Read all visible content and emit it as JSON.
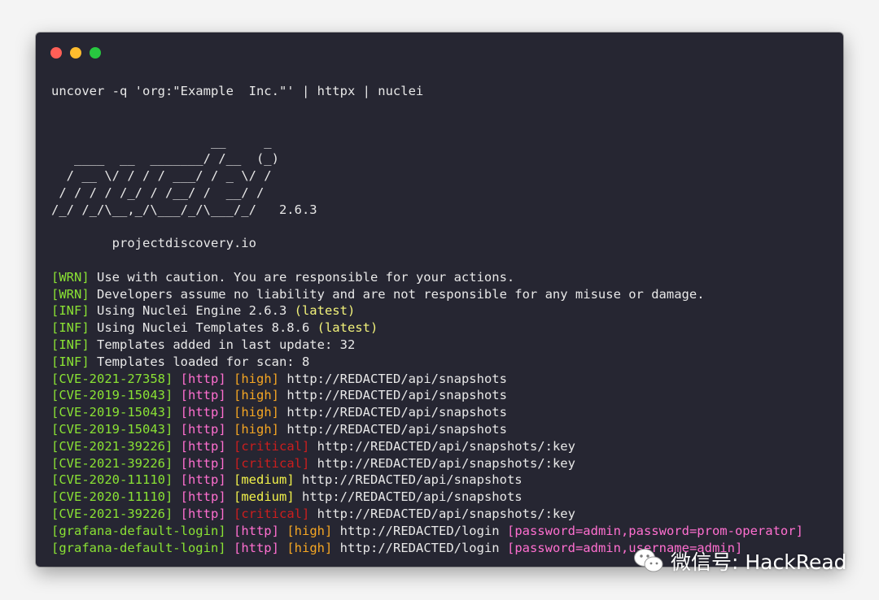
{
  "colors": {
    "close": "#ff5f57",
    "minimize": "#febc2e",
    "maximize": "#28c840",
    "tag_green": "#8ae234",
    "tag_pink": "#ff6fd0",
    "severity_high": "#f5a623",
    "severity_critical": "#cc1e1e",
    "severity_medium": "#f2f24a",
    "latest": "#f2f27a",
    "extracted": "#ff6fd0"
  },
  "window_controls": [
    "close",
    "minimize",
    "maximize"
  ],
  "command": "uncover -q 'org:\"Example  Inc.\"' | httpx | nuclei",
  "banner": {
    "ascii": "                     __     _\n   ____  __  _______/ /__  (_)\n  / __ \\/ / / / ___/ / _ \\/ /\n / / / / /_/ / /__/ /  __/ /\n/_/ /_/\\__,_/\\___/_/\\___/_/   ",
    "version": "2.6.3",
    "site": "        projectdiscovery.io"
  },
  "log_lines": [
    {
      "tag": "[WRN]",
      "message": " Use with caution. You are responsible for your actions.",
      "note": ""
    },
    {
      "tag": "[WRN]",
      "message": " Developers assume no liability and are not responsible for any misuse or damage.",
      "note": ""
    },
    {
      "tag": "[INF]",
      "message": " Using Nuclei Engine 2.6.3 ",
      "note": "(latest)"
    },
    {
      "tag": "[INF]",
      "message": " Using Nuclei Templates 8.8.6 ",
      "note": "(latest)"
    },
    {
      "tag": "[INF]",
      "message": " Templates added in last update: 32",
      "note": ""
    },
    {
      "tag": "[INF]",
      "message": " Templates loaded for scan: 8",
      "note": ""
    }
  ],
  "findings": [
    {
      "template": "[CVE-2021-27358]",
      "protocol": "[http]",
      "severity": "[high]",
      "severity_level": "high",
      "url": "http://REDACTED/api/snapshots",
      "extracted": ""
    },
    {
      "template": "[CVE-2019-15043]",
      "protocol": "[http]",
      "severity": "[high]",
      "severity_level": "high",
      "url": "http://REDACTED/api/snapshots",
      "extracted": ""
    },
    {
      "template": "[CVE-2019-15043]",
      "protocol": "[http]",
      "severity": "[high]",
      "severity_level": "high",
      "url": "http://REDACTED/api/snapshots",
      "extracted": ""
    },
    {
      "template": "[CVE-2019-15043]",
      "protocol": "[http]",
      "severity": "[high]",
      "severity_level": "high",
      "url": "http://REDACTED/api/snapshots",
      "extracted": ""
    },
    {
      "template": "[CVE-2021-39226]",
      "protocol": "[http]",
      "severity": "[critical]",
      "severity_level": "critical",
      "url": "http://REDACTED/api/snapshots/:key",
      "extracted": ""
    },
    {
      "template": "[CVE-2021-39226]",
      "protocol": "[http]",
      "severity": "[critical]",
      "severity_level": "critical",
      "url": "http://REDACTED/api/snapshots/:key",
      "extracted": ""
    },
    {
      "template": "[CVE-2020-11110]",
      "protocol": "[http]",
      "severity": "[medium]",
      "severity_level": "medium",
      "url": "http://REDACTED/api/snapshots",
      "extracted": ""
    },
    {
      "template": "[CVE-2020-11110]",
      "protocol": "[http]",
      "severity": "[medium]",
      "severity_level": "medium",
      "url": "http://REDACTED/api/snapshots",
      "extracted": ""
    },
    {
      "template": "[CVE-2021-39226]",
      "protocol": "[http]",
      "severity": "[critical]",
      "severity_level": "critical",
      "url": "http://REDACTED/api/snapshots/:key",
      "extracted": ""
    },
    {
      "template": "[grafana-default-login]",
      "protocol": "[http]",
      "severity": "[high]",
      "severity_level": "high",
      "url": "http://REDACTED/login",
      "extracted": "[password=admin,password=prom-operator]"
    },
    {
      "template": "[grafana-default-login]",
      "protocol": "[http]",
      "severity": "[high]",
      "severity_level": "high",
      "url": "http://REDACTED/login",
      "extracted": "[password=admin,username=admin]"
    }
  ],
  "watermark": {
    "icon": "wechat-icon",
    "text": "微信号: HackRead"
  }
}
